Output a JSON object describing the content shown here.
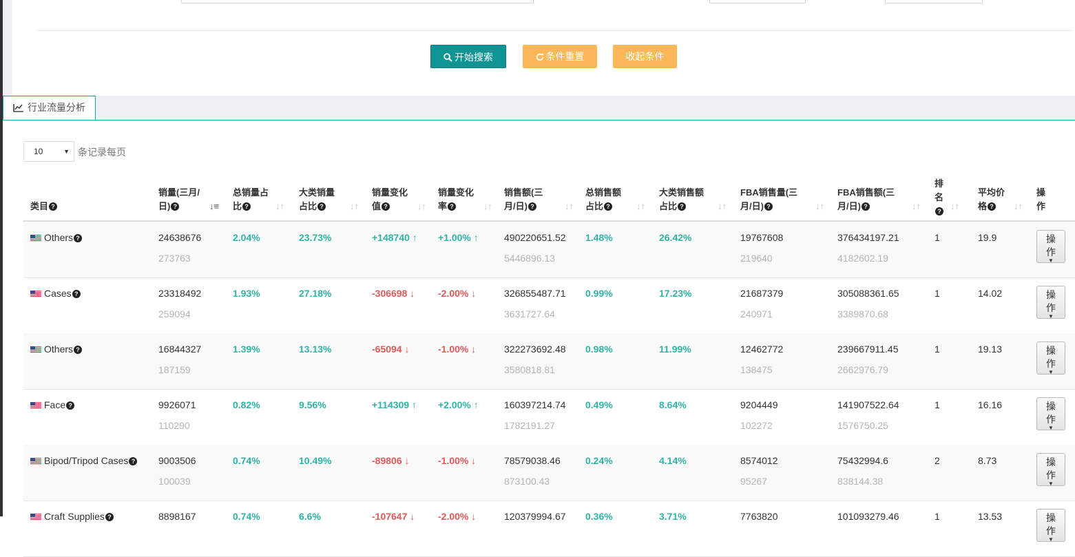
{
  "buttons": {
    "search": "开始搜索",
    "reset": "条件重置",
    "collapse": "收起条件"
  },
  "tab": {
    "label": "行业流量分析"
  },
  "page_size": {
    "value": "10",
    "label": "条记录每页"
  },
  "columns": [
    {
      "l1": "类目",
      "l2": ""
    },
    {
      "l1": "销量(三月/",
      "l2": "日)"
    },
    {
      "l1": "总销量占",
      "l2": "比"
    },
    {
      "l1": "大类销量",
      "l2": "占比"
    },
    {
      "l1": "销量变化",
      "l2": "值"
    },
    {
      "l1": "销量变化",
      "l2": "率"
    },
    {
      "l1": "销售额(三",
      "l2": "月/日)"
    },
    {
      "l1": "总销售额",
      "l2": "占比"
    },
    {
      "l1": "大类销售额",
      "l2": "占比"
    },
    {
      "l1": "FBA销售量(三",
      "l2": "月/日)"
    },
    {
      "l1": "FBA销售额(三",
      "l2": "月/日)"
    },
    {
      "l1": "排",
      "l2": "名",
      "l3": ""
    },
    {
      "l1": "平均价",
      "l2": "格"
    },
    {
      "l1": "操",
      "l2": "作"
    }
  ],
  "rows": [
    {
      "category": "Others",
      "sales": "24638676",
      "sales_daily": "273763",
      "share_total": "2.04%",
      "share_cat": "23.73%",
      "change_val": "+148740 ↑",
      "change_rate": "+1.00% ↑",
      "trend": "up",
      "revenue": "490220651.52",
      "revenue_daily": "5446896.13",
      "rev_share_total": "1.48%",
      "rev_share_cat": "26.42%",
      "fba_sales": "19767608",
      "fba_sales_daily": "219640",
      "fba_revenue": "376434197.21",
      "fba_revenue_daily": "4182602.19",
      "rank": "1",
      "avg_price": "19.9",
      "op1": "操",
      "op2": "作"
    },
    {
      "category": "Cases",
      "sales": "23318492",
      "sales_daily": "259094",
      "share_total": "1.93%",
      "share_cat": "27.18%",
      "change_val": "-306698 ↓",
      "change_rate": "-2.00% ↓",
      "trend": "down",
      "revenue": "326855487.71",
      "revenue_daily": "3631727.64",
      "rev_share_total": "0.99%",
      "rev_share_cat": "17.23%",
      "fba_sales": "21687379",
      "fba_sales_daily": "240971",
      "fba_revenue": "305088361.65",
      "fba_revenue_daily": "3389870.68",
      "rank": "1",
      "avg_price": "14.02",
      "op1": "操",
      "op2": "作"
    },
    {
      "category": "Others",
      "sales": "16844327",
      "sales_daily": "187159",
      "share_total": "1.39%",
      "share_cat": "13.13%",
      "change_val": "-65094 ↓",
      "change_rate": "-1.00% ↓",
      "trend": "down",
      "revenue": "322273692.48",
      "revenue_daily": "3580818.81",
      "rev_share_total": "0.98%",
      "rev_share_cat": "11.99%",
      "fba_sales": "12462772",
      "fba_sales_daily": "138475",
      "fba_revenue": "239667911.45",
      "fba_revenue_daily": "2662976.79",
      "rank": "1",
      "avg_price": "19.13",
      "op1": "操",
      "op2": "作"
    },
    {
      "category": "Face",
      "sales": "9926071",
      "sales_daily": "110290",
      "share_total": "0.82%",
      "share_cat": "9.56%",
      "change_val": "+114309 ↑",
      "change_rate": "+2.00% ↑",
      "trend": "up",
      "revenue": "160397214.74",
      "revenue_daily": "1782191.27",
      "rev_share_total": "0.49%",
      "rev_share_cat": "8.64%",
      "fba_sales": "9204449",
      "fba_sales_daily": "102272",
      "fba_revenue": "141907522.64",
      "fba_revenue_daily": "1576750.25",
      "rank": "1",
      "avg_price": "16.16",
      "op1": "操",
      "op2": "作"
    },
    {
      "category": "Bipod/Tripod Cases",
      "sales": "9003506",
      "sales_daily": "100039",
      "share_total": "0.74%",
      "share_cat": "10.49%",
      "change_val": "-89806 ↓",
      "change_rate": "-1.00% ↓",
      "trend": "down",
      "revenue": "78579038.46",
      "revenue_daily": "873100.43",
      "rev_share_total": "0.24%",
      "rev_share_cat": "4.14%",
      "fba_sales": "8574012",
      "fba_sales_daily": "95267",
      "fba_revenue": "75432994.6",
      "fba_revenue_daily": "838144.38",
      "rank": "2",
      "avg_price": "8.73",
      "op1": "操",
      "op2": "作"
    },
    {
      "category": "Craft Supplies",
      "sales": "8898167",
      "sales_daily": "",
      "share_total": "0.74%",
      "share_cat": "6.6%",
      "change_val": "-107647 ↓",
      "change_rate": "-2.00% ↓",
      "trend": "down",
      "revenue": "120379994.67",
      "revenue_daily": "",
      "rev_share_total": "0.36%",
      "rev_share_cat": "3.71%",
      "fba_sales": "7763820",
      "fba_sales_daily": "",
      "fba_revenue": "101093279.46",
      "fba_revenue_daily": "",
      "rank": "1",
      "avg_price": "13.53",
      "op1": "操",
      "op2": "作"
    }
  ],
  "colors": {
    "primary": "#0f9494",
    "warning": "#fcb858",
    "up": "#2fb3a6",
    "down": "#e25858"
  }
}
